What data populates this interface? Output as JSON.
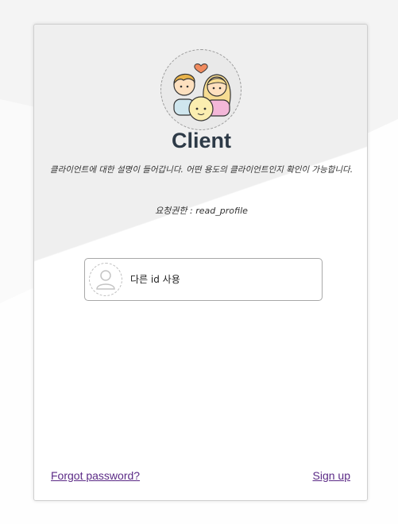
{
  "client": {
    "name": "Client",
    "description": "클라이언트에 대한 설명이 들어갑니다. 어떤 용도의 클라이언트인지 확인이 가능합니다.",
    "scope_text": "요청권한 : read_profile",
    "logo_icon": "family-icon"
  },
  "accounts": [
    {
      "label": "다른 id 사용",
      "icon": "user-avatar-icon"
    }
  ],
  "footer": {
    "forgot_label": "Forgot password?",
    "signup_label": "Sign up"
  },
  "colors": {
    "title": "#2d3a47",
    "link": "#5b2a86",
    "card_border": "#cfcfcf"
  }
}
